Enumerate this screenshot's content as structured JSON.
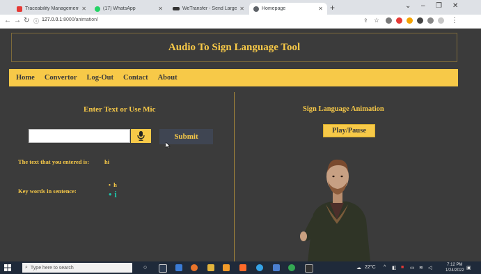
{
  "browser": {
    "tabs": [
      {
        "title": "Traceability Management with",
        "color": "#e53935"
      },
      {
        "title": "(17) WhatsApp",
        "color": "#25d366"
      },
      {
        "title": "WeTransfer - Send Large Files &",
        "color": "#333333"
      },
      {
        "title": "Homepage",
        "color": "#5f6368",
        "active": true
      }
    ],
    "url_host": "127.0.0.1",
    "url_path": ":8000/animation/"
  },
  "page": {
    "header_title": "Audio To Sign Language Tool",
    "nav": [
      "Home",
      "Convertor",
      "Log-Out",
      "Contact",
      "About"
    ],
    "left_title": "Enter Text or Use Mic",
    "text_input_value": "",
    "submit_label": "Submit",
    "entered_label": "The text that you entered is:",
    "entered_value": "hi",
    "keywords_label": "Key words in sentence:",
    "keywords": [
      "h",
      "i"
    ],
    "right_title": "Sign Language Animation",
    "play_label": "Play/Pause"
  },
  "taskbar": {
    "search_placeholder": "Type here to search",
    "temperature": "22°C",
    "time": "7:12 PM",
    "date": "1/24/2022"
  },
  "colors": {
    "accent": "#f7c948",
    "background": "#3b3b3b",
    "keyword_highlight": "#1fbfa6"
  }
}
